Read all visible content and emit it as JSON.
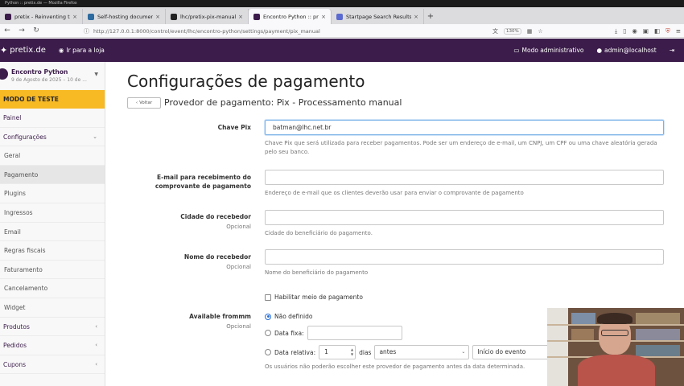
{
  "window": {
    "title": "Python :: pretix.de — Mozilla Firefox"
  },
  "tabs": [
    {
      "label": "pretix - Reinventing ticke",
      "active": false,
      "favicon": "pretix-icon"
    },
    {
      "label": "Self-hosting documentati",
      "active": false,
      "favicon": "doc-icon"
    },
    {
      "label": "lhc/pretix-pix-manual",
      "active": false,
      "favicon": "github-icon"
    },
    {
      "label": "Encontro Python :: pretix",
      "active": true,
      "favicon": "pretix-icon"
    },
    {
      "label": "Startpage Search Results",
      "active": false,
      "favicon": "search-icon"
    }
  ],
  "browser": {
    "url": "http://127.0.0.1:8000/control/event/lhc/encontro-python/settings/payment/pix_manual",
    "zoom": "130%"
  },
  "header": {
    "brand": "pretix.de",
    "store_link": "Ir para a loja",
    "admin_mode": "Modo administrativo",
    "user": "admin@localhost"
  },
  "sidebar": {
    "event_name": "Encontro Python",
    "event_date": "9 de Agosto de 2025 – 10 de ...",
    "test_mode": "MODO DE TESTE",
    "items": [
      {
        "label": "Painel",
        "sub": false,
        "active": false,
        "chevron": ""
      },
      {
        "label": "Configurações",
        "sub": false,
        "active": false,
        "chevron": "⌄"
      },
      {
        "label": "Geral",
        "sub": true,
        "active": false,
        "chevron": ""
      },
      {
        "label": "Pagamento",
        "sub": true,
        "active": true,
        "chevron": ""
      },
      {
        "label": "Plugins",
        "sub": true,
        "active": false,
        "chevron": ""
      },
      {
        "label": "Ingressos",
        "sub": true,
        "active": false,
        "chevron": ""
      },
      {
        "label": "Email",
        "sub": true,
        "active": false,
        "chevron": ""
      },
      {
        "label": "Regras fiscais",
        "sub": true,
        "active": false,
        "chevron": ""
      },
      {
        "label": "Faturamento",
        "sub": true,
        "active": false,
        "chevron": ""
      },
      {
        "label": "Cancelamento",
        "sub": true,
        "active": false,
        "chevron": ""
      },
      {
        "label": "Widget",
        "sub": true,
        "active": false,
        "chevron": ""
      },
      {
        "label": "Produtos",
        "sub": false,
        "active": false,
        "chevron": "‹"
      },
      {
        "label": "Pedidos",
        "sub": false,
        "active": false,
        "chevron": "‹"
      },
      {
        "label": "Cupons",
        "sub": false,
        "active": false,
        "chevron": "‹"
      }
    ]
  },
  "main": {
    "title": "Configurações de pagamento",
    "back_label": "Voltar",
    "subtitle": "Provedor de pagamento: Pix - Processamento manual",
    "pix_key": {
      "label": "Chave Pix",
      "value": "batman@lhc.net.br",
      "help": "Chave Pix que será utilizada para receber pagamentos. Pode ser um endereço de e-mail, um CNPJ, um CPF ou uma chave aleatória gerada pelo seu banco."
    },
    "email": {
      "label_line1": "E-mail para recebimento do",
      "label_line2": "comprovante de pagamento",
      "value": "",
      "help": "Endereço de e-mail que os clientes deverão usar para enviar o comprovante de pagamento"
    },
    "city": {
      "label": "Cidade do recebedor",
      "optional": "Opcional",
      "value": "",
      "help": "Cidade do beneficiário do pagamento."
    },
    "name": {
      "label": "Nome do recebedor",
      "optional": "Opcional",
      "value": "",
      "help": "Nome do beneficiário do pagamento"
    },
    "enable_label": "Habilitar meio de pagamento",
    "available_from": {
      "label": "Available frommm",
      "optional": "Opcional",
      "opt_undefined": "Não definido",
      "opt_fixed": "Data fixa:",
      "opt_relative": "Data relativa:",
      "relative_value": "1",
      "days_label": "dias",
      "before_option": "antes",
      "event_start_option": "Início do evento",
      "help": "Os usuários não poderão escolher este provedor de pagamento antes da data determinada."
    }
  }
}
